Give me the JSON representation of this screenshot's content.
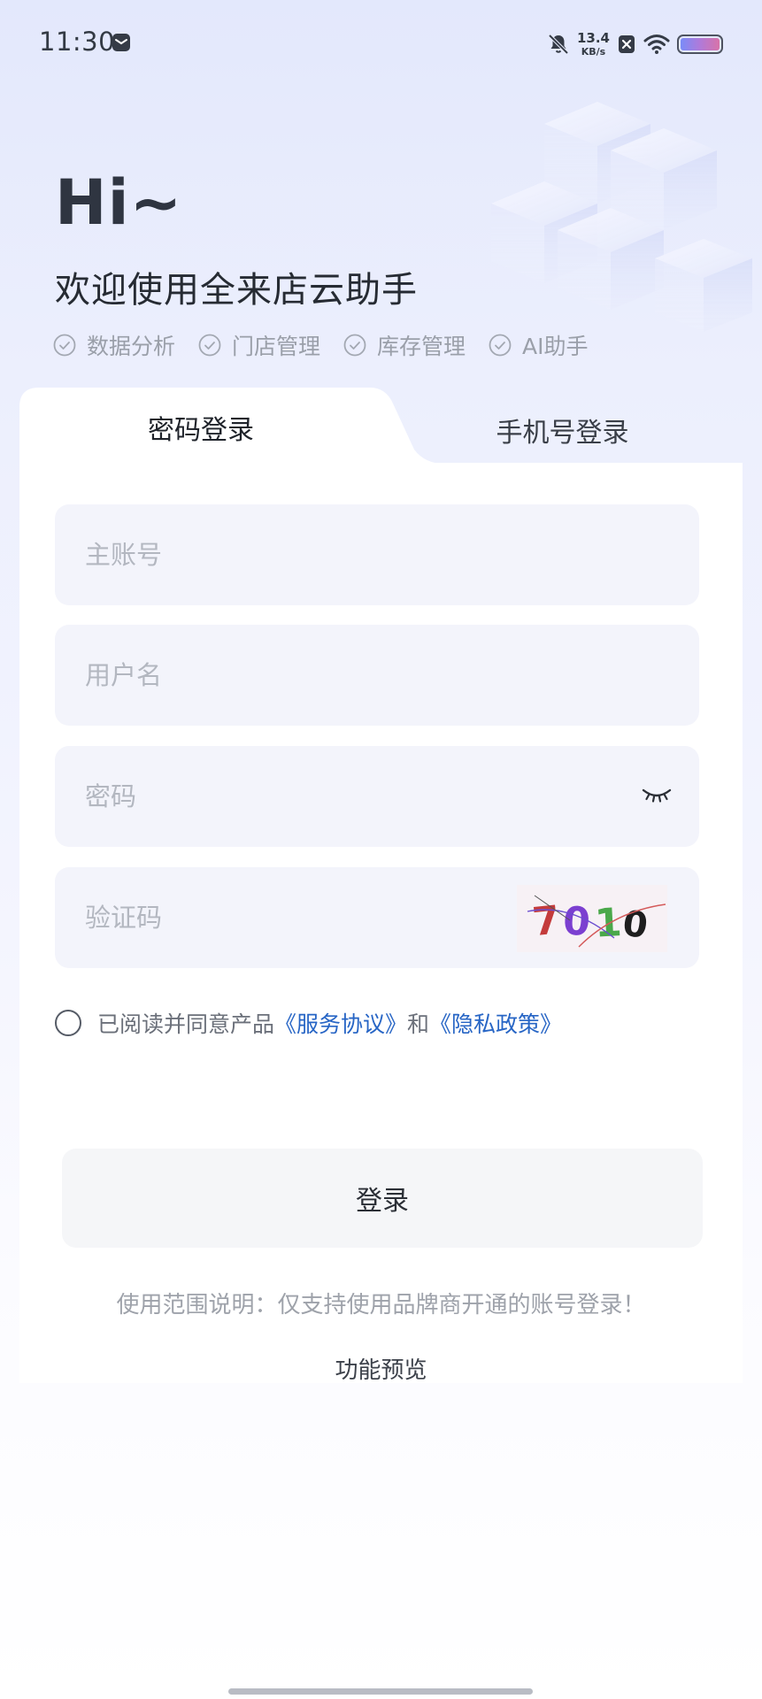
{
  "status_bar": {
    "time": "11:30",
    "net_speed_value": "13.4",
    "net_speed_unit": "KB/s",
    "battery_level": 1.0,
    "icons": [
      "message-icon",
      "bell-off-icon",
      "sim-x-icon",
      "wifi-icon",
      "battery-icon"
    ]
  },
  "hero": {
    "title": "Hi~",
    "subtitle": "欢迎使用全来店云助手",
    "features": [
      "数据分析",
      "门店管理",
      "库存管理",
      "AI助手"
    ]
  },
  "tabs": {
    "password_login": "密码登录",
    "phone_login": "手机号登录",
    "active": "password_login"
  },
  "form": {
    "account_placeholder": "主账号",
    "username_placeholder": "用户名",
    "password_placeholder": "密码",
    "captcha_placeholder": "验证码",
    "captcha_text": "7010"
  },
  "agreement": {
    "prefix": "已阅读并同意产品",
    "service_link": "《服务协议》",
    "conjunction": "和",
    "privacy_link": "《隐私政策》"
  },
  "login_button": "登录",
  "scope_note": "使用范围说明：仅支持使用品牌商开通的账号登录！",
  "preview_link": "功能预览",
  "colors": {
    "link": "#2765c5",
    "field_bg": "#f3f4fb",
    "text_dark": "#2b2f36",
    "text_muted": "#9a9fa9"
  }
}
